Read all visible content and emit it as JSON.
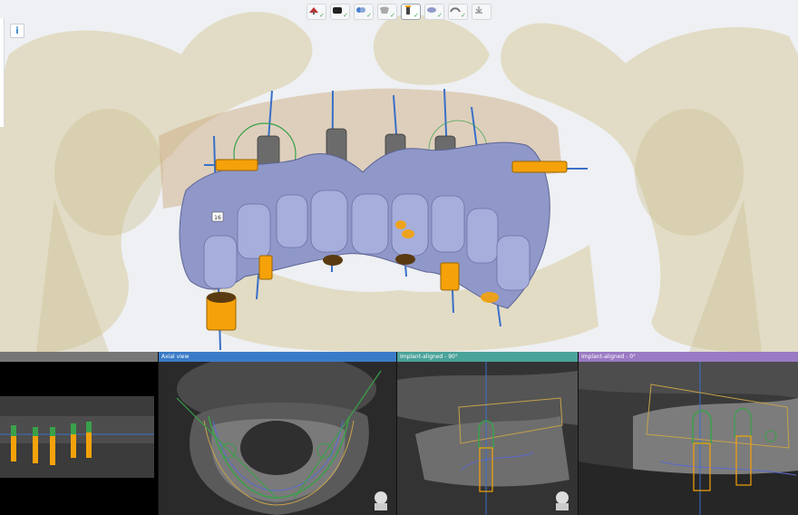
{
  "toolbar": {
    "tools": [
      {
        "icon": "scan-icon",
        "done": true
      },
      {
        "icon": "model-icon",
        "done": true
      },
      {
        "icon": "alignment-icon",
        "done": true
      },
      {
        "icon": "teeth-icon",
        "done": true
      },
      {
        "icon": "implant-icon",
        "done": true,
        "active": true
      },
      {
        "icon": "sleeve-icon",
        "done": true
      },
      {
        "icon": "guide-icon",
        "done": true
      },
      {
        "icon": "export-icon",
        "done": false
      }
    ]
  },
  "info_button": {
    "label": "i"
  },
  "tooth_tag": {
    "label": "16"
  },
  "panels": {
    "overview": {
      "title": ""
    },
    "axial": {
      "title": "Axial view",
      "color": "#3a7bc8"
    },
    "implant90": {
      "title": "Implant-aligned - 90°",
      "color": "#4aa39a"
    },
    "implant0": {
      "title": "Implant-aligned - 0°",
      "color": "#9a7ac4"
    }
  },
  "colors": {
    "implant": "#f5a20a",
    "guide": "#8f98c9",
    "bone": "#d9cca0",
    "axis": "#3a6fc8"
  }
}
